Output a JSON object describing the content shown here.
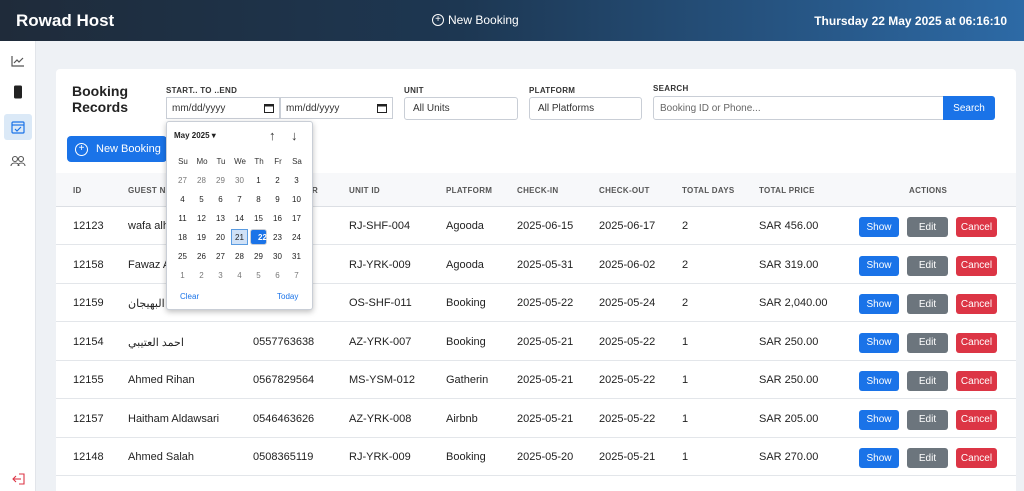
{
  "header": {
    "brand": "Rowad Host",
    "new_booking_label": "New Booking",
    "datetime": "Thursday 22 May 2025 at 06:16:10"
  },
  "sidebar": {
    "icons": [
      "chart-line-icon",
      "tablet-icon",
      "calendar-check-icon",
      "users-icon",
      "logout-icon"
    ],
    "active": "calendar-check-icon"
  },
  "page": {
    "title_line1": "Booking",
    "title_line2": "Records"
  },
  "filters": {
    "date_label": "START.. TO ..END",
    "start_placeholder": "mm/dd/yyyy",
    "end_placeholder": "mm/dd/yyyy",
    "unit_label": "UNIT",
    "unit_value": "All Units",
    "platform_label": "PLATFORM",
    "platform_value": "All Platforms",
    "search_label": "SEARCH",
    "search_placeholder": "Booking ID or Phone...",
    "search_button": "Search"
  },
  "actions": {
    "new_booking": "New Booking"
  },
  "table": {
    "columns": [
      "ID",
      "GUEST NA",
      "R",
      "UNIT ID",
      "PLATFORM",
      "CHECK-IN",
      "CHECK-OUT",
      "TOTAL DAYS",
      "TOTAL PRICE",
      "ACTIONS"
    ],
    "buttons": {
      "show": "Show",
      "edit": "Edit",
      "cancel": "Cancel"
    },
    "rows": [
      {
        "id": "12123",
        "guest": "wafa alh",
        "phone": "",
        "unit": "RJ-SHF-004",
        "platform": "Agooda",
        "checkin": "2025-06-15",
        "checkout": "2025-06-17",
        "days": "2",
        "price": "SAR 456.00"
      },
      {
        "id": "12158",
        "guest": "Fawaz A",
        "phone": "3",
        "unit": "RJ-YRK-009",
        "platform": "Agooda",
        "checkin": "2025-05-31",
        "checkout": "2025-06-02",
        "days": "2",
        "price": "SAR 319.00"
      },
      {
        "id": "12159",
        "guest": "عبدالله البهيجان",
        "phone": "2",
        "unit": "OS-SHF-011",
        "platform": "Booking",
        "checkin": "2025-05-22",
        "checkout": "2025-05-24",
        "days": "2",
        "price": "SAR 2,040.00"
      },
      {
        "id": "12154",
        "guest": "احمد العتيبي",
        "phone": "0557763638",
        "unit": "AZ-YRK-007",
        "platform": "Booking",
        "checkin": "2025-05-21",
        "checkout": "2025-05-22",
        "days": "1",
        "price": "SAR 250.00"
      },
      {
        "id": "12155",
        "guest": "Ahmed Rihan",
        "phone": "0567829564",
        "unit": "MS-YSM-012",
        "platform": "Gatherin",
        "checkin": "2025-05-21",
        "checkout": "2025-05-22",
        "days": "1",
        "price": "SAR 250.00"
      },
      {
        "id": "12157",
        "guest": "Haitham Aldawsari",
        "phone": "0546463626",
        "unit": "AZ-YRK-008",
        "platform": "Airbnb",
        "checkin": "2025-05-21",
        "checkout": "2025-05-22",
        "days": "1",
        "price": "SAR 205.00"
      },
      {
        "id": "12148",
        "guest": "Ahmed Salah",
        "phone": "0508365119",
        "unit": "RJ-YRK-009",
        "platform": "Booking",
        "checkin": "2025-05-20",
        "checkout": "2025-05-21",
        "days": "1",
        "price": "SAR 270.00"
      }
    ]
  },
  "datepicker": {
    "month": "May 2025 ▾",
    "weekdays": [
      "Su",
      "Mo",
      "Tu",
      "We",
      "Th",
      "Fr",
      "Sa"
    ],
    "weeks": [
      [
        "27",
        "28",
        "29",
        "30",
        "1",
        "2",
        "3"
      ],
      [
        "4",
        "5",
        "6",
        "7",
        "8",
        "9",
        "10"
      ],
      [
        "11",
        "12",
        "13",
        "14",
        "15",
        "16",
        "17"
      ],
      [
        "18",
        "19",
        "20",
        "21",
        "22",
        "23",
        "24"
      ],
      [
        "25",
        "26",
        "27",
        "28",
        "29",
        "30",
        "31"
      ],
      [
        "1",
        "2",
        "3",
        "4",
        "5",
        "6",
        "7"
      ]
    ],
    "hovered": "21",
    "selected": "22",
    "clear": "Clear",
    "today": "Today"
  }
}
